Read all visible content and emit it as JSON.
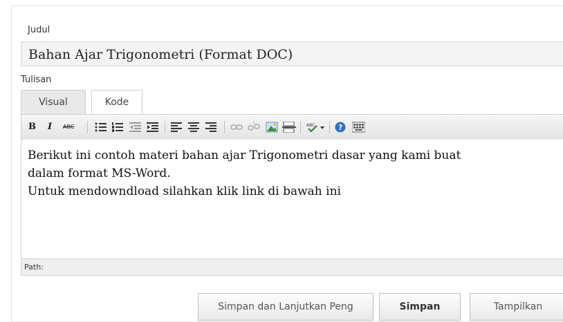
{
  "form": {
    "title_label": "Judul",
    "title_value": "Bahan Ajar Trigonometri (Format DOC)",
    "content_label": "Tulisan"
  },
  "tabs": [
    {
      "label": "Visual",
      "active": true
    },
    {
      "label": "Kode",
      "active": false
    }
  ],
  "toolbar": {
    "bold_label": "B",
    "italic_label": "I",
    "strike_label": "ABC",
    "icons": [
      "bold-icon",
      "italic-icon",
      "strikethrough-icon",
      "bullet-list-icon",
      "numbered-list-icon",
      "outdent-icon",
      "indent-icon",
      "align-left-icon",
      "align-center-icon",
      "align-right-icon",
      "link-icon",
      "unlink-icon",
      "image-icon",
      "page-break-icon",
      "spellcheck-icon",
      "help-icon",
      "kitchen-sink-icon"
    ]
  },
  "editor": {
    "lines": [
      "Berikut ini contoh materi bahan ajar Trigonometri dasar yang kami buat",
      "dalam format MS-Word.",
      "Untuk mendowndload silahkan klik link di bawah ini"
    ],
    "status_path": "Path:"
  },
  "buttons": {
    "save_continue": "Simpan dan Lanjutkan Peng",
    "save": "Simpan",
    "preview": "Tampilkan"
  }
}
